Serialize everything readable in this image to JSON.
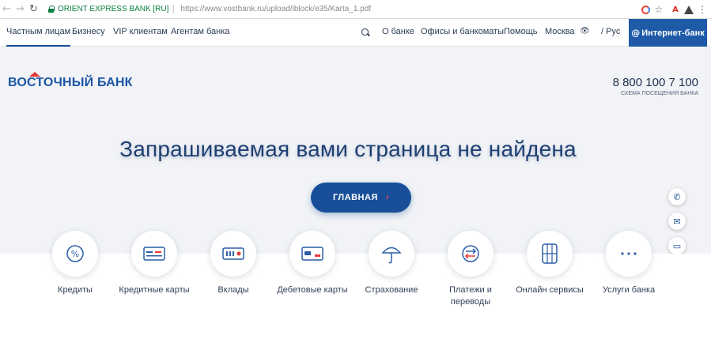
{
  "browser": {
    "site_identity": "ORIENT EXPRESS BANK [RU]",
    "url": "https://www.vostbank.ru/upload/iblock/e35/Karta_1.pdf"
  },
  "topnav": {
    "segments": [
      "Частным лицам",
      "Бизнесу",
      "VIP клиентам",
      "Агентам банка"
    ],
    "links": [
      "О банке",
      "Офисы и банкоматы",
      "Помощь",
      "Москва"
    ],
    "lang": "Рус",
    "ibank": "Интернет-банк"
  },
  "header": {
    "logo": "ВОСТОЧНЫЙ БАНК",
    "phone": "8 800 100 7 100",
    "phone_sub": "СХЕМА ПОСЕЩЕНИЯ БАНКА"
  },
  "error": {
    "title": "Запрашиваемая вами страница не найдена",
    "home_button": "ГЛАВНАЯ"
  },
  "services": [
    {
      "label": "Кредиты",
      "icon": "percent-icon"
    },
    {
      "label": "Кредитные карты",
      "icon": "credit-card-icon"
    },
    {
      "label": "Вклады",
      "icon": "deposit-icon"
    },
    {
      "label": "Дебетовые карты",
      "icon": "debit-card-icon"
    },
    {
      "label": "Страхование",
      "icon": "umbrella-icon"
    },
    {
      "label": "Платежи и переводы",
      "icon": "transfer-icon"
    },
    {
      "label": "Онлайн сервисы",
      "icon": "online-icon"
    },
    {
      "label": "Услуги банка",
      "icon": "more-icon"
    }
  ],
  "colors": {
    "brand": "#1b55a5",
    "button": "#184f98",
    "hero_bg": "#f1f3f6",
    "accent_red": "#e33b3b"
  }
}
